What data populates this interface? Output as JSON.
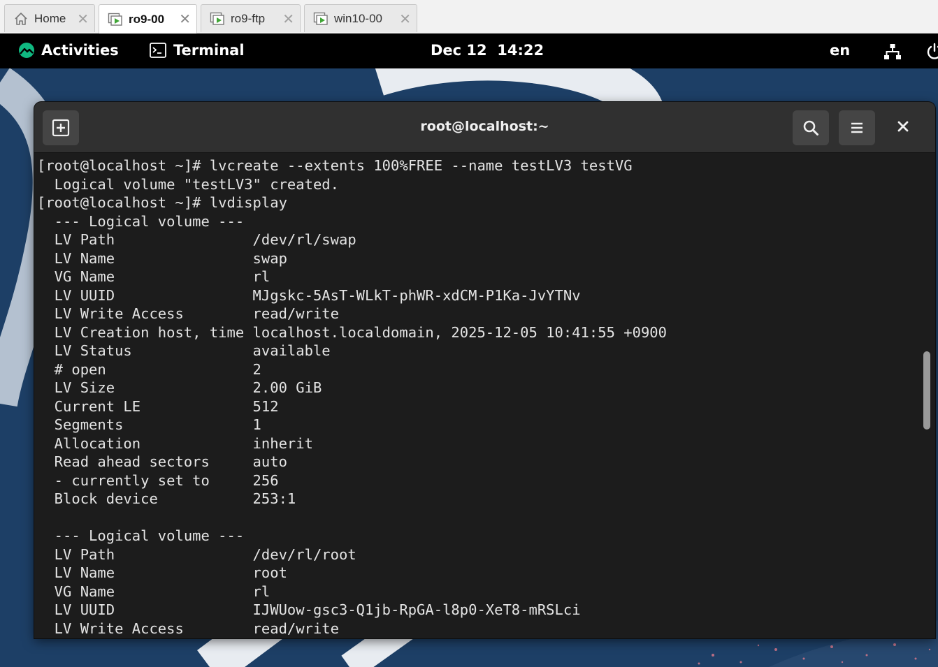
{
  "vm_tabs": [
    {
      "label": "Home",
      "icon": "home-icon",
      "active": false
    },
    {
      "label": "ro9-00",
      "icon": "vm-running-icon",
      "active": true
    },
    {
      "label": "ro9-ftp",
      "icon": "vm-running-icon",
      "active": false
    },
    {
      "label": "win10-00",
      "icon": "vm-running-icon",
      "active": false
    }
  ],
  "topbar": {
    "activities_label": "Activities",
    "app_label": "Terminal",
    "clock": "Dec 12  14:22",
    "language": "en"
  },
  "terminal": {
    "title": "root@localhost:~",
    "lines": [
      "[root@localhost ~]# lvcreate --extents 100%FREE --name testLV3 testVG",
      "  Logical volume \"testLV3\" created.",
      "[root@localhost ~]# lvdisplay",
      "  --- Logical volume ---",
      "  LV Path                /dev/rl/swap",
      "  LV Name                swap",
      "  VG Name                rl",
      "  LV UUID                MJgskc-5AsT-WLkT-phWR-xdCM-P1Ka-JvYTNv",
      "  LV Write Access        read/write",
      "  LV Creation host, time localhost.localdomain, 2025-12-05 10:41:55 +0900",
      "  LV Status              available",
      "  # open                 2",
      "  LV Size                2.00 GiB",
      "  Current LE             512",
      "  Segments               1",
      "  Allocation             inherit",
      "  Read ahead sectors     auto",
      "  - currently set to     256",
      "  Block device           253:1",
      "",
      "  --- Logical volume ---",
      "  LV Path                /dev/rl/root",
      "  LV Name                root",
      "  VG Name                rl",
      "  LV UUID                IJWUow-gsc3-Q1jb-RpGA-l8p0-XeT8-mRSLci",
      "  LV Write Access        read/write"
    ]
  },
  "colors": {
    "desktop_bg": "#1d3f66",
    "topbar_bg": "#000000",
    "terminal_bg": "#1c1c1c",
    "headerbar_bg": "#303030",
    "vm_running_accent": "#3fa535",
    "rocky_logo": "#10b981"
  }
}
